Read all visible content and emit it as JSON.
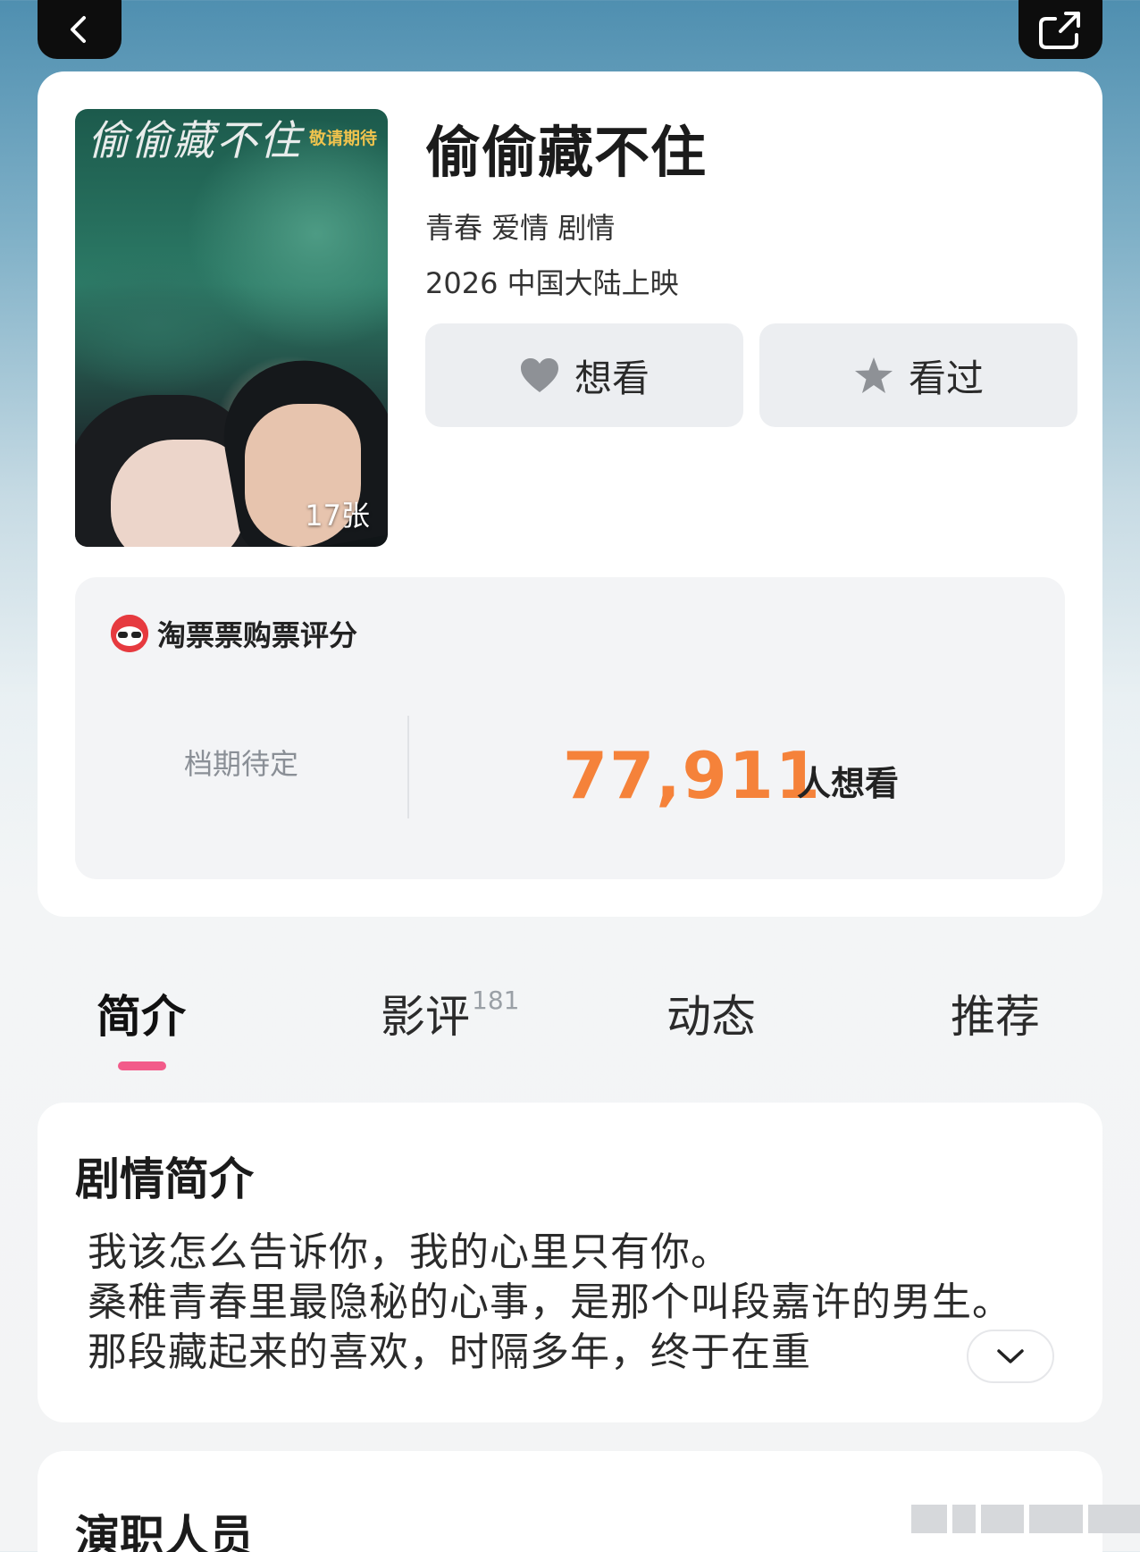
{
  "nav": {
    "back_icon": "chevron-left-icon",
    "share_icon": "share-icon"
  },
  "movie": {
    "title": "偷偷藏不住",
    "genres": "青春 爱情 剧情",
    "release": "2026 中国大陆上映",
    "poster": {
      "title_art": "偷偷藏不住",
      "tag": "敬请期待",
      "photo_count": "17张"
    }
  },
  "actions": {
    "want_label": "想看",
    "seen_label": "看过"
  },
  "rating": {
    "source_label": "淘票票购票评分",
    "status": "档期待定",
    "want_count": "77,911",
    "want_suffix": "人想看",
    "accent_color": "#f5823a"
  },
  "tabs": [
    {
      "label": "简介",
      "active": true
    },
    {
      "label": "影评",
      "badge": "181"
    },
    {
      "label": "动态"
    },
    {
      "label": "推荐"
    }
  ],
  "synopsis": {
    "heading": "剧情简介",
    "text": "我该怎么告诉你，我的心里只有你。\n桑稚青春里最隐秘的心事，是那个叫段嘉许的男生。那段藏起来的喜欢，时隔多年，终于在重"
  },
  "cast": {
    "heading": "演职人员"
  },
  "colors": {
    "tab_indicator": "#f25b8a"
  }
}
